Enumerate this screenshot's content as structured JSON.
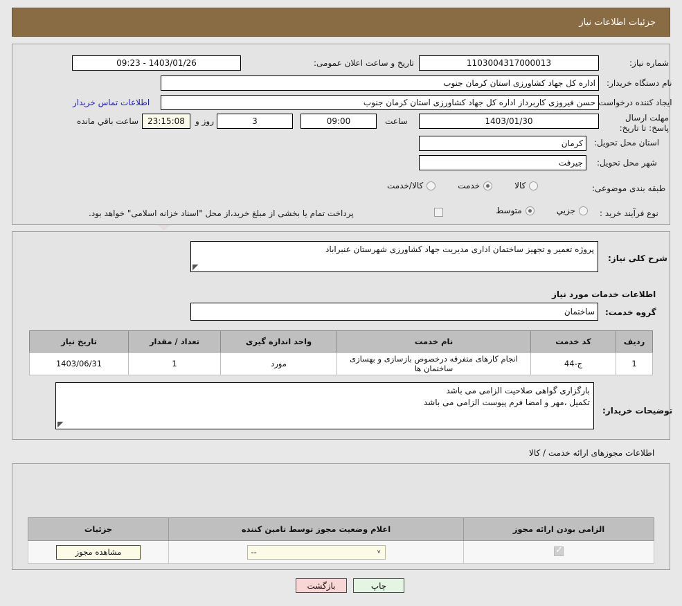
{
  "header": {
    "title": "جزئیات اطلاعات نیاز"
  },
  "top": {
    "need_number_label": "شماره نیاز:",
    "need_number_value": "1103004317000013",
    "announce_label": "تاریخ و ساعت اعلان عمومی:",
    "announce_value": "1403/01/26 - 09:23",
    "buyer_org_label": "نام دستگاه خریدار:",
    "buyer_org_value": "اداره کل جهاد کشاورزی استان کرمان   جنوب",
    "creator_label": "ایجاد کننده درخواست:",
    "creator_value": "حسن فیروزی کاربرداز اداره کل جهاد کشاورزی استان کرمان   جنوب",
    "contact_link": "اطلاعات تماس خریدار",
    "deadline_label": "مهلت ارسال پاسخ: تا تاریخ:",
    "deadline_date": "1403/01/30",
    "deadline_time_label": "ساعت",
    "deadline_time": "09:00",
    "remaining_days": "3",
    "remaining_days_label": "روز و",
    "remaining_clock": "23:15:08",
    "remaining_suffix": "ساعت باقي مانده",
    "province_label": "استان محل تحویل:",
    "province_value": "کرمان",
    "city_label": "شهر محل تحویل:",
    "city_value": "جیرفت",
    "category_label": "طبقه بندی موضوعی:",
    "category_options": [
      {
        "label": "کالا",
        "selected": false
      },
      {
        "label": "خدمت",
        "selected": true
      },
      {
        "label": "کالا/خدمت",
        "selected": false
      }
    ],
    "process_label": "نوع فرآیند خرید :",
    "process_options": [
      {
        "label": "جزیي",
        "selected": false
      },
      {
        "label": "متوسط",
        "selected": true
      }
    ],
    "treasury_checkbox_checked": false,
    "treasury_note": "پرداخت تمام یا بخشی از مبلغ خرید،از محل \"اسناد خزانه اسلامی\" خواهد بود."
  },
  "mid": {
    "summary_label": "شرح کلی نیاز:",
    "summary_value": "پروژه تعمیر و تجهیز ساختمان اداری مدیریت جهاد کشاورزی شهرستان عنبراباد",
    "services_caption": "اطلاعات خدمات مورد نیاز",
    "service_group_label": "گروه خدمت:",
    "service_group_value": "ساختمان",
    "table": {
      "headers": [
        "ردیف",
        "کد خدمت",
        "نام خدمت",
        "واحد اندازه گیری",
        "تعداد / مقدار",
        "تاریخ نیاز"
      ],
      "rows": [
        {
          "row": "1",
          "code": "ج-44",
          "name": "انجام کارهای متفرقه درخصوص بازسازی و بهسازی ساختمان ها",
          "unit": "مورد",
          "qty": "1",
          "date": "1403/06/31"
        }
      ]
    },
    "notes_label": "توضیحات خریدار:",
    "notes_value": "بارگزاری گواهی صلاحیت الزامی می باشد\nتکمیل ،مهر و امضا فرم پیوست الزامی می باشد"
  },
  "bottom": {
    "caption": "اطلاعات مجوزهای ارائه خدمت / کالا",
    "table": {
      "headers": [
        "الزامی بودن ارائه مجوز",
        "اعلام وضعیت مجوز توسط تامین کننده",
        "جزئیات"
      ],
      "rows": [
        {
          "required_checked": true,
          "status_value": "--",
          "details_button": "مشاهده مجوز"
        }
      ]
    }
  },
  "footer": {
    "print_label": "چاپ",
    "back_label": "بازگشت"
  },
  "watermark": {
    "text": "AriaTender.net"
  },
  "colors": {
    "header_bar": "#8a6c44",
    "panel_bg": "#e4e4e4",
    "page_bg": "#e8e8e8",
    "link": "#2020cc",
    "table_header": "#bfbfbf",
    "print_button": "#e4f5e4",
    "back_button": "#f9d6d6",
    "yellow_field": "#fbfbe8"
  }
}
